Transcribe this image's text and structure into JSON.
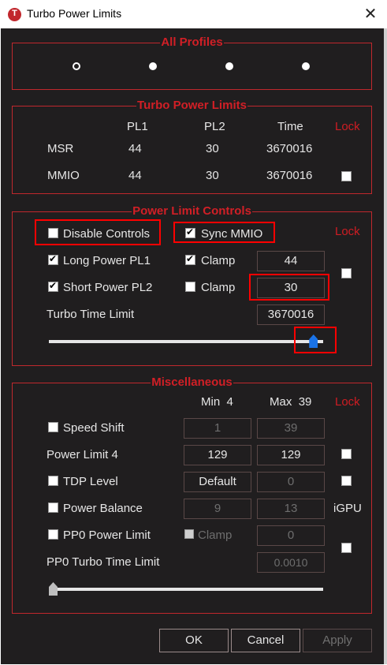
{
  "window": {
    "title": "Turbo Power Limits",
    "icon_letter": "T",
    "close_glyph": "✕"
  },
  "all_profiles": {
    "title": "All Profiles",
    "selected_index": 0,
    "profile_count": 4
  },
  "turbo_power_limits": {
    "title": "Turbo Power Limits",
    "headers": {
      "pl1": "PL1",
      "pl2": "PL2",
      "time": "Time",
      "lock": "Lock"
    },
    "rows": [
      {
        "label": "MSR",
        "pl1": "44",
        "pl2": "30",
        "time": "3670016"
      },
      {
        "label": "MMIO",
        "pl1": "44",
        "pl2": "30",
        "time": "3670016",
        "lock_checked": false
      }
    ]
  },
  "power_limit_controls": {
    "title": "Power Limit Controls",
    "disable_controls": {
      "label": "Disable Controls",
      "checked": false
    },
    "sync_mmio": {
      "label": "Sync MMIO",
      "checked": true
    },
    "lock": {
      "label": "Lock",
      "checked": false
    },
    "long_power": {
      "label": "Long Power PL1",
      "checked": true,
      "clamp_label": "Clamp",
      "clamp_checked": true,
      "value": "44"
    },
    "short_power": {
      "label": "Short Power PL2",
      "checked": true,
      "clamp_label": "Clamp",
      "clamp_checked": false,
      "value": "30"
    },
    "turbo_time": {
      "label": "Turbo Time Limit",
      "value": "3670016",
      "slider_fraction": 0.98
    }
  },
  "miscellaneous": {
    "title": "Miscellaneous",
    "min_label": "Min",
    "min_value": "4",
    "max_label": "Max",
    "max_value": "39",
    "lock_label": "Lock",
    "speed_shift": {
      "label": "Speed Shift",
      "checked": false,
      "min": "1",
      "max": "39"
    },
    "power_limit_4": {
      "label": "Power Limit 4",
      "min": "129",
      "max": "129",
      "lock_checked": false
    },
    "tdp_level": {
      "label": "TDP Level",
      "checked": false,
      "value": "Default",
      "max": "0",
      "lock_checked": false
    },
    "power_balance": {
      "label": "Power Balance",
      "checked": false,
      "min": "9",
      "max": "13",
      "suffix": "iGPU"
    },
    "pp0_power_limit": {
      "label": "PP0 Power Limit",
      "checked": false,
      "clamp_label": "Clamp",
      "clamp_checked": false,
      "value": "0",
      "lock_checked": false
    },
    "pp0_turbo_time": {
      "label": "PP0 Turbo Time Limit",
      "value": "0.0010",
      "slider_fraction": 0.0
    }
  },
  "buttons": {
    "ok": "OK",
    "cancel": "Cancel",
    "apply": "Apply"
  },
  "colors": {
    "background": "#201e1f",
    "accent_red": "#d11f26",
    "highlight_red": "#ff0000",
    "slider_thumb": "#1a73e8"
  }
}
